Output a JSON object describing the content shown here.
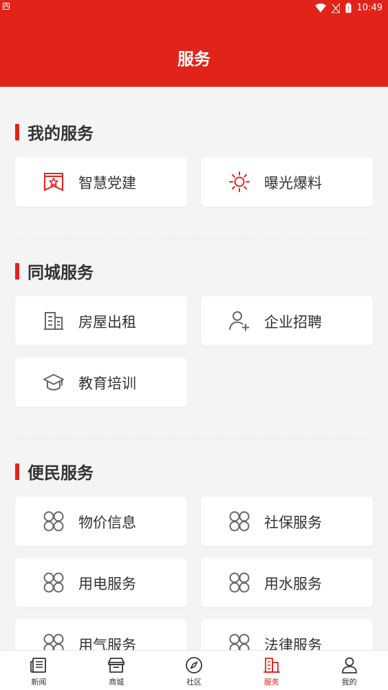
{
  "status_bar": {
    "time": "10:49"
  },
  "header": {
    "title": "服务"
  },
  "sections": [
    {
      "title": "我的服务",
      "items": [
        {
          "label": "智慧党建",
          "icon": "party-badge-icon"
        },
        {
          "label": "曝光爆料",
          "icon": "sun-icon"
        }
      ]
    },
    {
      "title": "同城服务",
      "items": [
        {
          "label": "房屋出租",
          "icon": "building-icon"
        },
        {
          "label": "企业招聘",
          "icon": "add-user-icon"
        },
        {
          "label": "教育培训",
          "icon": "graduation-cap-icon"
        }
      ]
    },
    {
      "title": "便民服务",
      "items": [
        {
          "label": "物价信息",
          "icon": "four-circles-icon"
        },
        {
          "label": "社保服务",
          "icon": "four-circles-icon"
        },
        {
          "label": "用电服务",
          "icon": "four-circles-icon"
        },
        {
          "label": "用水服务",
          "icon": "four-circles-icon"
        },
        {
          "label": "用气服务",
          "icon": "four-circles-icon"
        },
        {
          "label": "法律服务",
          "icon": "four-circles-icon"
        }
      ]
    }
  ],
  "tabbar": {
    "items": [
      {
        "label": "新闻",
        "icon": "newspaper-icon"
      },
      {
        "label": "商城",
        "icon": "store-icon"
      },
      {
        "label": "社区",
        "icon": "compass-icon"
      },
      {
        "label": "服务",
        "icon": "city-buildings-icon",
        "active": true
      },
      {
        "label": "我的",
        "icon": "person-icon"
      }
    ]
  },
  "colors": {
    "accent": "#e2231a",
    "background": "#f4f4f4",
    "icon_gray": "#666666"
  }
}
